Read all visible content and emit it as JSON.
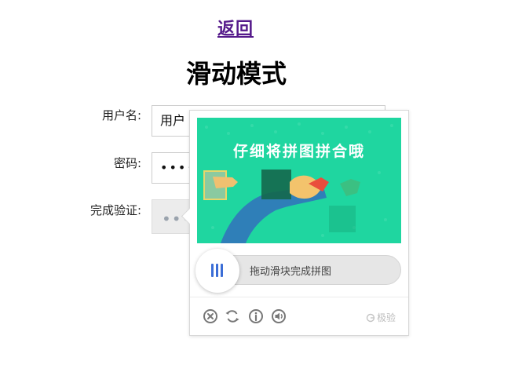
{
  "nav": {
    "back_label": "返回"
  },
  "page": {
    "title": "滑动模式"
  },
  "form": {
    "username_label": "用户名:",
    "username_value": "用户",
    "password_label": "密码:",
    "password_value": "••••••",
    "verify_label": "完成验证:",
    "verify_placeholder": "•••"
  },
  "captcha": {
    "image_caption": "仔细将拼图拼合哦",
    "slider_hint": "拖动滑块完成拼图",
    "icons": [
      "close-icon",
      "refresh-icon",
      "info-icon",
      "audio-icon"
    ],
    "brand": "极验",
    "colors": {
      "background": "#1fd6a0",
      "accent": "#3b6dd6"
    }
  }
}
